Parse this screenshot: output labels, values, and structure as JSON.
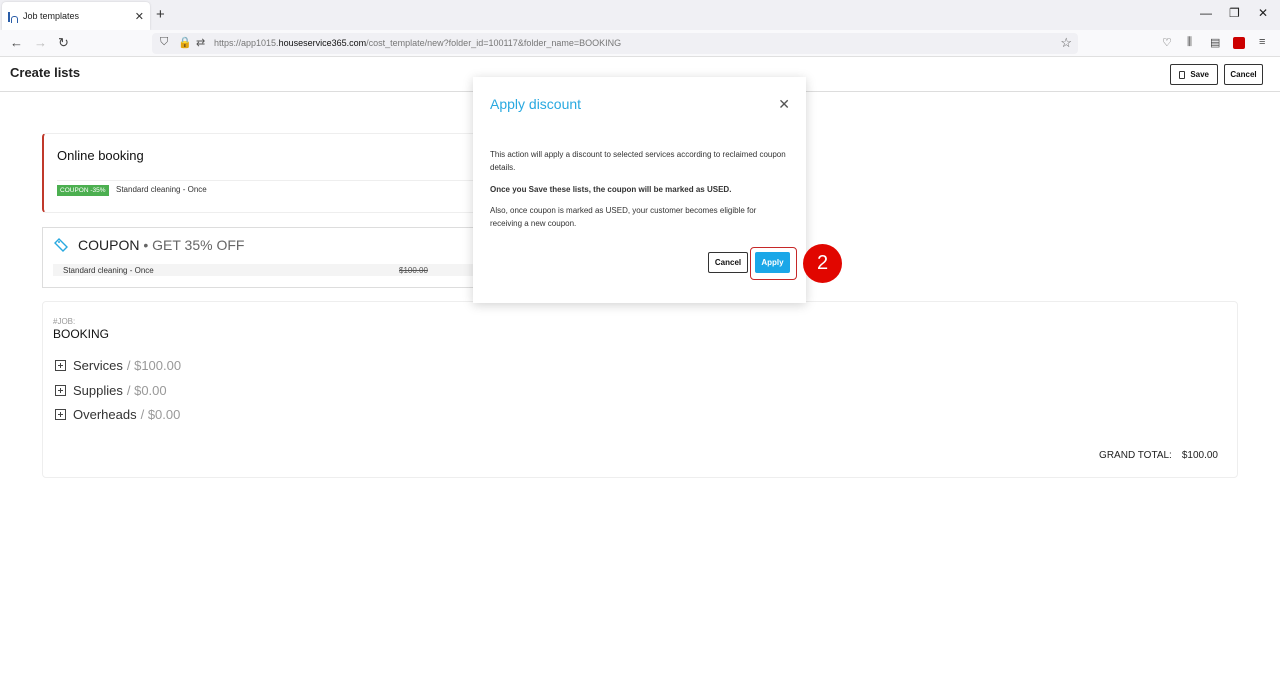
{
  "browser": {
    "tab_title": "Job templates",
    "url_prefix": "https://app1015.",
    "url_domain": "houseservice365.com",
    "url_path": "/cost_template/new?folder_id=100117&folder_name=BOOKING"
  },
  "header": {
    "title": "Create lists",
    "save_label": "Save",
    "cancel_label": "Cancel"
  },
  "online_booking": {
    "title": "Online booking",
    "badge": "COUPON -35%",
    "service": "Standard cleaning - Once"
  },
  "coupon": {
    "label": "COUPON",
    "offer": "• GET 35% OFF",
    "service": "Standard cleaning - Once",
    "original_price": "$100.00"
  },
  "job": {
    "label": "#JOB:",
    "name": "BOOKING",
    "sections": [
      {
        "name": "Services",
        "amount": "/ $100.00"
      },
      {
        "name": "Supplies",
        "amount": "/ $0.00"
      },
      {
        "name": "Overheads",
        "amount": "/ $0.00"
      }
    ],
    "grand_total_label": "GRAND TOTAL:",
    "grand_total_value": "$100.00"
  },
  "modal": {
    "title": "Apply discount",
    "p1": "This action will apply a discount to selected services according to reclaimed coupon details.",
    "p2": "Once you Save these lists, the coupon will be marked as USED.",
    "p3": "Also, once coupon is marked as USED, your customer becomes eligible for receiving a new coupon.",
    "cancel_label": "Cancel",
    "apply_label": "Apply"
  },
  "annotation": {
    "step_number": "2"
  },
  "colors": {
    "accent": "#29a9e0",
    "apply_button": "#1aa7e8",
    "badge_green": "#4caf50",
    "step_red": "#e10600"
  }
}
